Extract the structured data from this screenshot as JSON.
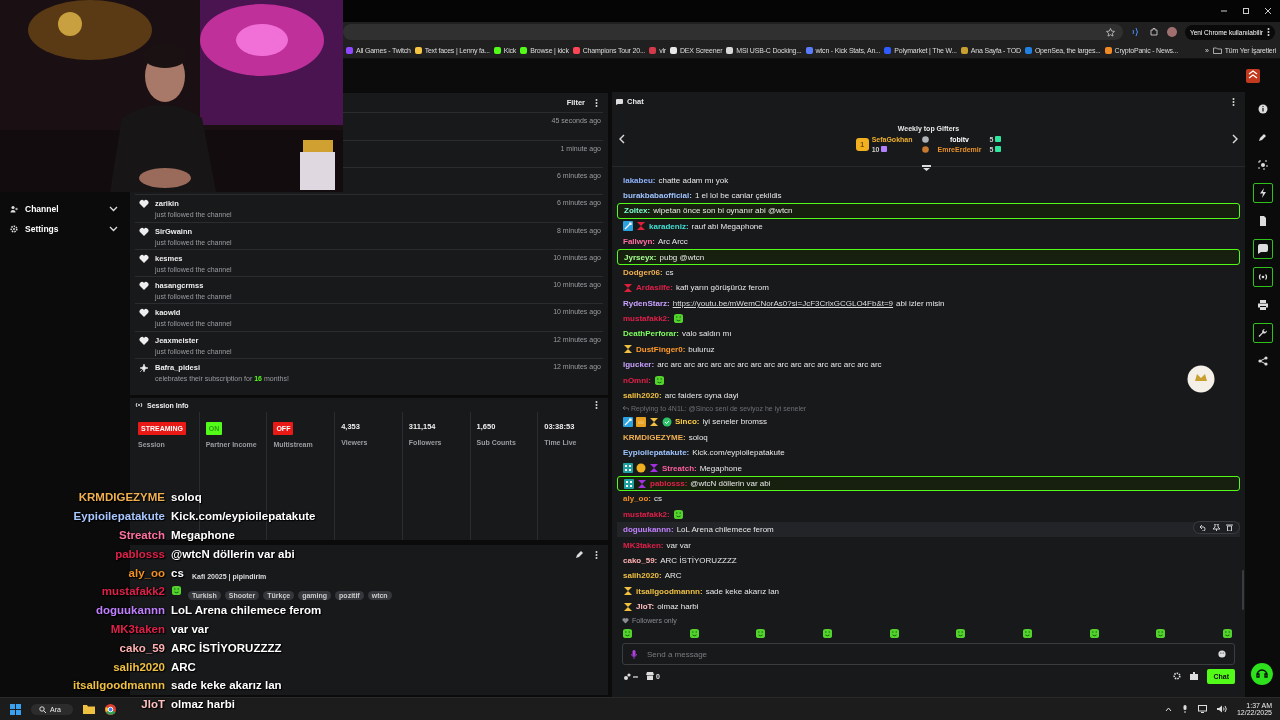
{
  "browser": {
    "update_button": "Yeni Chrome kullanılabilir",
    "bookmarks": [
      {
        "label": "All Games - Twitch",
        "color": "#9146ff"
      },
      {
        "label": "Text faces | Lenny fa...",
        "color": "#f5c542"
      },
      {
        "label": "Kick",
        "color": "#53fc18"
      },
      {
        "label": "Browse | kick",
        "color": "#53fc18"
      },
      {
        "label": "Champions Tour 20...",
        "color": "#ff4655"
      },
      {
        "label": "vlr",
        "color": "#d23a4a"
      },
      {
        "label": "DEX Screener",
        "color": "#e8e8e8"
      },
      {
        "label": "MSI USB-C Docking...",
        "color": "#d8d8d8"
      },
      {
        "label": "wtcn - Kick Stats, An...",
        "color": "#5a7cff"
      },
      {
        "label": "Polymarket | The W...",
        "color": "#2e5cff"
      },
      {
        "label": "Ana Sayfa - TOD",
        "color": "#c8a030"
      },
      {
        "label": "OpenSea, the larges...",
        "color": "#2081e2"
      },
      {
        "label": "CryptoPanic - News...",
        "color": "#f08a24"
      }
    ],
    "more": "»",
    "all_bookmarks": "Tüm Yer İşaretleri"
  },
  "sidebar": [
    {
      "label": "Channel",
      "expanded": false
    },
    {
      "label": "Settings",
      "expanded": false
    }
  ],
  "activity": {
    "filter": "Filter",
    "events": [
      {
        "time": "45 seconds ago"
      },
      {
        "time": "1 minute ago"
      },
      {
        "time": "6 minutes ago"
      },
      {
        "kind": "follow",
        "name": "zarikin",
        "action": "just followed the channel",
        "time": "6 minutes ago"
      },
      {
        "kind": "follow",
        "name": "SirGwainn",
        "action": "just followed the channel",
        "time": "8 minutes ago"
      },
      {
        "kind": "follow",
        "name": "kesmes",
        "action": "just followed the channel",
        "time": "10 minutes ago"
      },
      {
        "kind": "follow",
        "name": "hasangcrmss",
        "action": "just followed the channel",
        "time": "10 minutes ago"
      },
      {
        "kind": "follow",
        "name": "kaowld",
        "action": "just followed the channel",
        "time": "10 minutes ago"
      },
      {
        "kind": "follow",
        "name": "Jeaxmeister",
        "action": "just followed the channel",
        "time": "12 minutes ago"
      },
      {
        "kind": "subscription",
        "name": "Bafra_pidesi",
        "action": "celebrates their subscription for **16** months!",
        "time": "12 minutes ago"
      }
    ]
  },
  "session": {
    "title": "Session Info",
    "stats": [
      {
        "kind": "badge",
        "value": "STREAMING",
        "color": "#e91916",
        "label": "Session"
      },
      {
        "kind": "badge",
        "value": "ON",
        "color": "#53fc18",
        "label": "Partner Income"
      },
      {
        "kind": "badge",
        "value": "OFF",
        "color": "#e91916",
        "label": "Multistream"
      },
      {
        "kind": "number",
        "value": "4,353",
        "label": "Viewers"
      },
      {
        "kind": "number",
        "value": "311,154",
        "label": "Followers"
      },
      {
        "kind": "number",
        "value": "1,650",
        "label": "Sub Counts"
      },
      {
        "kind": "number",
        "value": "03:38:53",
        "label": "Time Live"
      }
    ]
  },
  "stream": {
    "title": "Kafi 20025 | pipindirim",
    "tags": [
      "Turkish",
      "Shooter",
      "Türkçe",
      "gaming",
      "pozitif",
      "wtcn"
    ]
  },
  "overlay": [
    {
      "name": "KRMDIGEZYME",
      "color": "#f0b050",
      "text": "soloq"
    },
    {
      "name": "Eypioilepatakute",
      "color": "#a8c8ff",
      "text": "Kick.com/eypioilepatakute"
    },
    {
      "name": "Streatch",
      "color": "#ff6fa0",
      "text": "Megaphone"
    },
    {
      "name": "pablosss",
      "color": "#e0204a",
      "text": "@wtcN döllerin var abi"
    },
    {
      "name": "aly_oo",
      "color": "#f09020",
      "text": "cs"
    },
    {
      "name": "mustafakk2",
      "color": "#e0204a",
      "kind": "emote"
    },
    {
      "name": "doguukannn",
      "color": "#c080ff",
      "text": "LoL Arena chilemece ferom"
    },
    {
      "name": "MK3taken",
      "color": "#e0204a",
      "text": "var var"
    },
    {
      "name": "cako_59",
      "color": "#ffb0b0",
      "text": "ARC İSTİYORUZZZZ"
    },
    {
      "name": "salih2020",
      "color": "#f0c040",
      "text": "ARC"
    },
    {
      "name": "itsallgoodmannn",
      "color": "#f0c040",
      "text": "sade keke akarız lan"
    },
    {
      "name": "JloT",
      "color": "#ffc0c0",
      "text": "olmaz harbi"
    }
  ],
  "chat": {
    "title": "Chat",
    "gifters": {
      "title": "Weekly top Gifters",
      "leaders": [
        {
          "rank": "1",
          "name": "SefaGokhan",
          "count": "10",
          "color": "#f0b030"
        },
        {
          "name": "fobitv",
          "count": "5",
          "color": "#ffffff"
        },
        {
          "name": "EmreErdemir",
          "count": "5",
          "color": "#e8902a"
        }
      ]
    },
    "messages": [
      {
        "name": "lakabeu:",
        "color": "#8fb3ff",
        "text": "chatte adam mı yok",
        "highlighted": false,
        "hovered": false
      },
      {
        "name": "burakbabaofficial:",
        "color": "#9ec4ff",
        "text": "1 el lol be canlar çekildis",
        "highlighted": false,
        "hovered": false
      },
      {
        "name": "Zoitex:",
        "color": "#7fffd4",
        "text": "wipetan önce son bi oynanır abi @wtcn",
        "highlighted": true,
        "hovered": false
      },
      {
        "badges": [
          {
            "kind": "sword"
          },
          {
            "kind": "hourglass"
          }
        ],
        "name": "karadeniz:",
        "color": "#40e0d0",
        "text": "rauf abi Megaphone",
        "highlighted": false,
        "hovered": false
      },
      {
        "name": "Fallwyn:",
        "color": "#ff6fa0",
        "text": "Arc Arcc",
        "highlighted": false,
        "hovered": false
      },
      {
        "name": "Jyrseyx:",
        "color": "#a6ff8f",
        "text": "pubg @wtcn",
        "highlighted": true,
        "hovered": false
      },
      {
        "name": "Dodger06:",
        "color": "#f0b050",
        "text": "cs",
        "highlighted": false,
        "hovered": false
      },
      {
        "badges": [
          {
            "kind": "hourglass"
          }
        ],
        "name": "Ardasilfe:",
        "color": "#e0204a",
        "text": "kafi yarın görüşürüz ferom",
        "highlighted": false,
        "hovered": false
      },
      {
        "name": "RydenStarz:",
        "color": "#c8a0ff",
        "link": "https://youtu.be/mWemCNorAs0?si=JcF3CrlxGCGLO4Fb&t=9",
        "text": "abi izler misin",
        "highlighted": false,
        "hovered": false
      },
      {
        "name": "mustafakk2:",
        "color": "#e0204a",
        "kind": "emote",
        "highlighted": false,
        "hovered": false
      },
      {
        "name": "DeathPerforar:",
        "color": "#7fff5f",
        "text": "valo saldın mı",
        "highlighted": false,
        "hovered": false
      },
      {
        "badges": [
          {
            "kind": "hourglass-gold"
          }
        ],
        "name": "DustFinger0:",
        "color": "#ff9a2a",
        "text": "buluruz",
        "highlighted": false,
        "hovered": false
      },
      {
        "name": "lgucker:",
        "color": "#c8a0ff",
        "text": "arc arc arc arc arc arc arc arc arc arc arc arc arc arc arc arc arc",
        "highlighted": false,
        "hovered": false
      },
      {
        "name": "nOmni:",
        "color": "#e0204a",
        "kind": "emote",
        "highlighted": false,
        "hovered": false
      },
      {
        "name": "salih2020:",
        "color": "#f0c040",
        "text": "arc faiders oyna dayi",
        "highlighted": false,
        "hovered": false
      },
      {
        "reply": "Replying to 4N1L: @Sinco seni de seviyoz he iyi seneler",
        "badges": [
          {
            "kind": "sword"
          },
          {
            "kind": "crown"
          },
          {
            "kind": "hourglass-gold"
          },
          {
            "kind": "verified"
          }
        ],
        "name": "Sinco:",
        "color": "#ffd040",
        "text": "iyi seneler bromss",
        "highlighted": false,
        "hovered": false
      },
      {
        "name": "KRMDIGEZYME:",
        "color": "#f0b050",
        "text": "soloq",
        "highlighted": false,
        "hovered": false
      },
      {
        "name": "Eypioilepatakute:",
        "color": "#9ec4ff",
        "text": "Kick.com/eypioilepatakute",
        "highlighted": false,
        "hovered": false
      },
      {
        "badges": [
          {
            "kind": "grid"
          },
          {
            "kind": "coin"
          },
          {
            "kind": "hourglass-purple"
          }
        ],
        "name": "Streatch:",
        "color": "#ff5fa0",
        "text": "Megaphone",
        "highlighted": false,
        "hovered": false
      },
      {
        "badges": [
          {
            "kind": "grid"
          },
          {
            "kind": "hourglass-purple"
          }
        ],
        "name": "pablosss:",
        "color": "#e0204a",
        "text": "@wtcN döllerin var abi",
        "highlighted": true,
        "hovered": false
      },
      {
        "name": "aly_oo:",
        "color": "#f09020",
        "text": "cs",
        "highlighted": false,
        "hovered": false
      },
      {
        "name": "mustafakk2:",
        "color": "#e0204a",
        "kind": "emote",
        "highlighted": false,
        "hovered": false
      },
      {
        "name": "doguukannn:",
        "color": "#c080ff",
        "text": "LoL Arena chilemece ferom",
        "highlighted": false,
        "hovered": true
      },
      {
        "name": "MK3taken:",
        "color": "#e0204a",
        "text": "var var",
        "highlighted": false,
        "hovered": false
      },
      {
        "name": "cako_59:",
        "color": "#ffb0b0",
        "text": "ARC İSTİYORUZZZZ",
        "highlighted": false,
        "hovered": false
      },
      {
        "name": "salih2020:",
        "color": "#f0c040",
        "text": "ARC",
        "highlighted": false,
        "hovered": false
      },
      {
        "badges": [
          {
            "kind": "hourglass-gold"
          }
        ],
        "name": "itsallgoodmannn:",
        "color": "#f0c040",
        "text": "sade keke akarız lan",
        "highlighted": false,
        "hovered": false
      },
      {
        "badges": [
          {
            "kind": "hourglass-gold"
          }
        ],
        "name": "JloT:",
        "color": "#ffc0c0",
        "text": "olmaz harbi",
        "highlighted": false,
        "hovered": false
      }
    ],
    "followers_only": "Followers only",
    "placeholder": "Send a message",
    "points": "∞",
    "store_count": "0",
    "send": "Chat"
  },
  "rail": [
    {
      "highlighted": false
    },
    {
      "highlighted": false
    },
    {
      "highlighted": false
    },
    {
      "highlighted": true
    },
    {
      "highlighted": false
    },
    {
      "highlighted": true
    },
    {
      "highlighted": true
    },
    {
      "highlighted": false
    },
    {
      "highlighted": true
    },
    {
      "highlighted": false
    }
  ],
  "taskbar": {
    "search": "Ara",
    "time": "1:37 AM",
    "date": "12/22/2025"
  }
}
